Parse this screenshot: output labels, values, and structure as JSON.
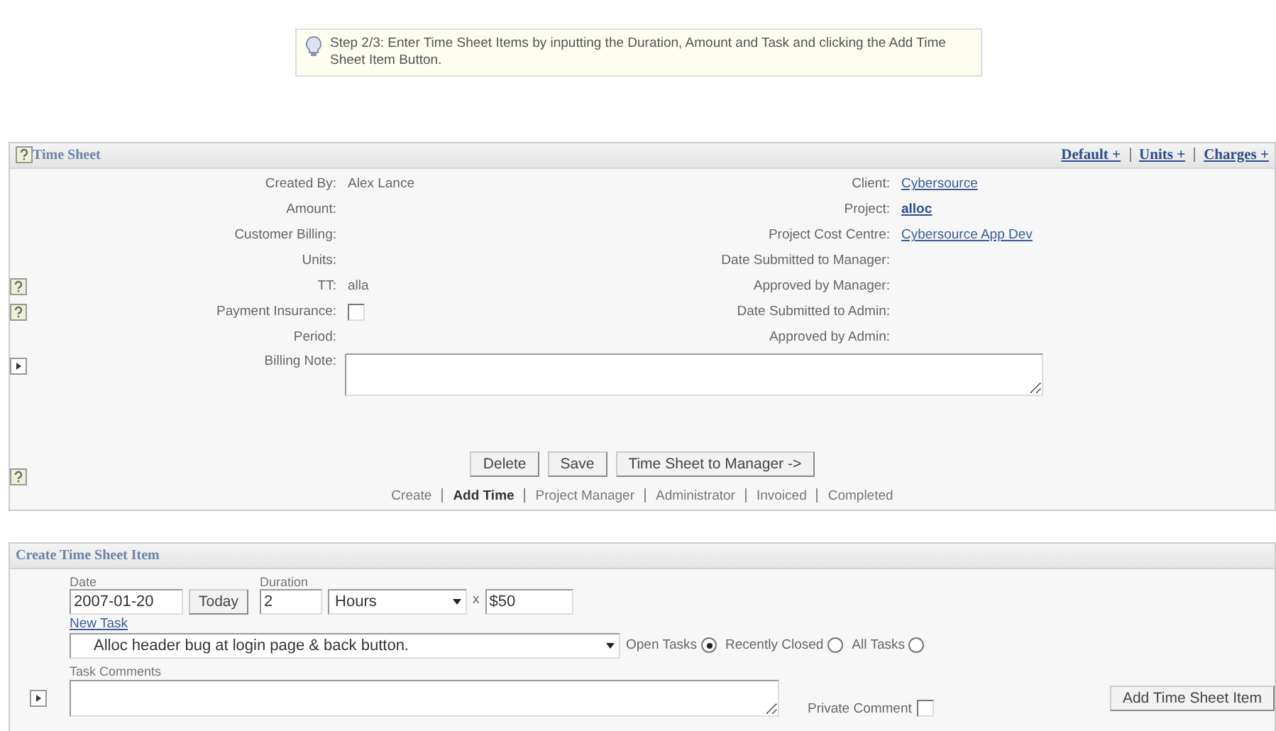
{
  "hint": {
    "text": "Step 2/3: Enter Time Sheet Items by inputting the Duration, Amount and Task and clicking the Add Time Sheet Item Button."
  },
  "time_sheet": {
    "title": "Time Sheet",
    "header_links": [
      {
        "label": "Default +"
      },
      {
        "label": "Units +"
      },
      {
        "label": "Charges +"
      }
    ],
    "left_fields": [
      {
        "label": "Created By:",
        "kind": "text",
        "value": "Alex Lance"
      },
      {
        "label": "Amount:",
        "kind": "text"
      },
      {
        "label": "Customer Billing:",
        "kind": "text"
      },
      {
        "label": "Units:",
        "kind": "text"
      },
      {
        "label": "TT:",
        "kind": "text",
        "value": "alla"
      },
      {
        "label": "Payment Insurance:",
        "kind": "checkbox",
        "checked": false
      },
      {
        "label": "Period:",
        "kind": "text"
      }
    ],
    "right_fields": [
      {
        "label": "Client:",
        "kind": "link",
        "value": "Cybersource"
      },
      {
        "label": "Project:",
        "kind": "bold_link",
        "value": "alloc"
      },
      {
        "label": "Project Cost Centre:",
        "kind": "link",
        "value": "Cybersource App Dev"
      },
      {
        "label": "Date Submitted to Manager:",
        "kind": "text"
      },
      {
        "label": "Approved by Manager:",
        "kind": "text"
      },
      {
        "label": "Date Submitted to Admin:",
        "kind": "text"
      },
      {
        "label": "Approved by Admin:",
        "kind": "text"
      }
    ],
    "billing_note": {
      "label": "Billing Note:"
    },
    "buttons": [
      "Delete",
      "Save",
      "Time Sheet to Manager ->"
    ],
    "steps": [
      {
        "label": "Create",
        "selected": false
      },
      {
        "label": "Add Time",
        "selected": true
      },
      {
        "label": "Project Manager",
        "selected": false
      },
      {
        "label": "Administrator",
        "selected": false
      },
      {
        "label": "Invoiced",
        "selected": false
      },
      {
        "label": "Completed",
        "selected": false
      }
    ]
  },
  "create_item": {
    "title": "Create Time Sheet Item",
    "date": {
      "label": "Date",
      "value": "2007-01-20"
    },
    "today_button": "Today",
    "duration": {
      "label": "Duration",
      "value": "2"
    },
    "unit_select": {
      "value": "Hours"
    },
    "rate": {
      "label": "x",
      "value": "$50"
    },
    "new_task_link": "New Task",
    "task_select": {
      "value": "Alloc header bug at login page & back button."
    },
    "task_filters": [
      {
        "label": "Open Tasks",
        "selected": true
      },
      {
        "label": "Recently Closed",
        "selected": false
      },
      {
        "label": "All Tasks",
        "selected": false
      }
    ],
    "task_comments": {
      "label": "Task Comments"
    },
    "private_comment": {
      "label": "Private Comment",
      "checked": false
    },
    "add_button": "Add Time Sheet Item"
  }
}
